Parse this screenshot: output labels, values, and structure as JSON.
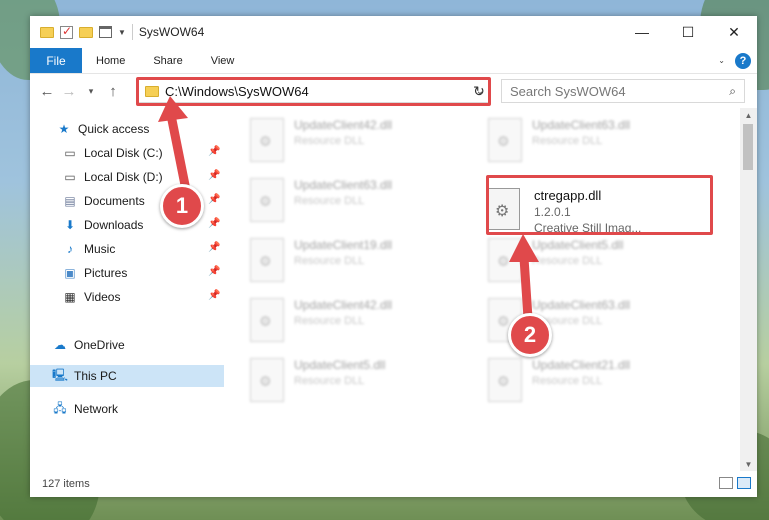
{
  "window": {
    "title": "SysWOW64",
    "controls": [
      "—",
      "☐",
      "✕"
    ]
  },
  "ribbon": {
    "tabs": [
      "File",
      "Home",
      "Share",
      "View"
    ],
    "help": "?"
  },
  "address": {
    "path": "C:\\Windows\\SysWOW64",
    "search_placeholder": "Search SysWOW64"
  },
  "nav": {
    "items": [
      {
        "label": "Quick access",
        "icon": "star-icon"
      },
      {
        "label": "Local Disk (C:)",
        "icon": "drive-icon",
        "pinned": true
      },
      {
        "label": "Local Disk (D:)",
        "icon": "drive-icon",
        "pinned": true
      },
      {
        "label": "Documents",
        "icon": "documents-icon",
        "pinned": true
      },
      {
        "label": "Downloads",
        "icon": "downloads-icon",
        "pinned": true
      },
      {
        "label": "Music",
        "icon": "music-icon",
        "pinned": true
      },
      {
        "label": "Pictures",
        "icon": "pictures-icon",
        "pinned": true
      },
      {
        "label": "Videos",
        "icon": "videos-icon",
        "pinned": true
      },
      {
        "label": "OneDrive",
        "icon": "cloud-icon"
      },
      {
        "label": "This PC",
        "icon": "computer-icon",
        "selected": true
      },
      {
        "label": "Network",
        "icon": "network-icon"
      }
    ]
  },
  "files": {
    "blurred": [
      {
        "name": "UpdateClient42.dll",
        "type": "Resource DLL"
      },
      {
        "name": "UpdateClient63.dll",
        "type": "Resource DLL"
      },
      {
        "name": "UpdateClient63.dll",
        "type": "Resource DLL"
      },
      {
        "name": "UpdateClient19.dll",
        "type": "Resource DLL"
      },
      {
        "name": "UpdateClient5.dll",
        "type": "Resource DLL"
      },
      {
        "name": "UpdateClient42.dll",
        "type": "Resource DLL"
      },
      {
        "name": "UpdateClient63.dll",
        "type": "Resource DLL"
      },
      {
        "name": "UpdateClient5.dll",
        "type": "Resource DLL"
      },
      {
        "name": "UpdateClient21.dll",
        "type": "Resource DLL"
      }
    ],
    "highlighted": {
      "name": "ctregapp.dll",
      "version": "1.2.0.1",
      "description": "Creative Still Imag..."
    }
  },
  "status": {
    "count": "127 items"
  },
  "annotations": {
    "step1": "1",
    "step2": "2",
    "color": "#e0494b"
  }
}
